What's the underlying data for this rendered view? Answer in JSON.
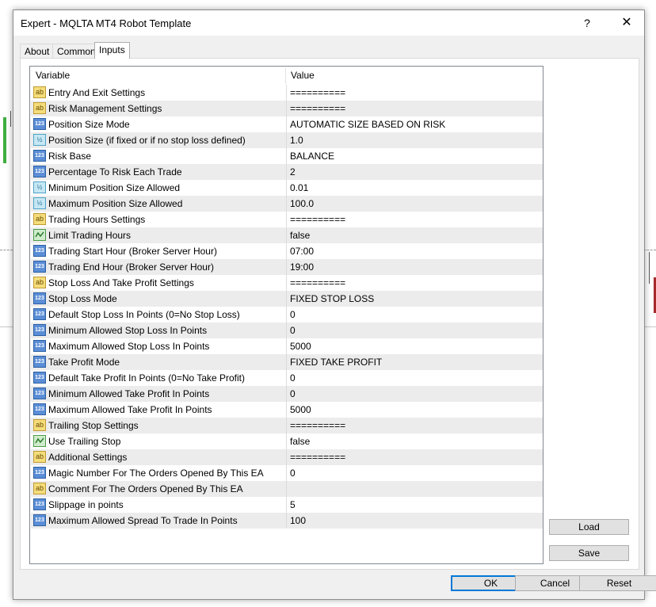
{
  "window": {
    "title": "Expert - MQLTA MT4 Robot Template",
    "help_label": "?",
    "close_label": "✕"
  },
  "tabs": [
    {
      "label": "About"
    },
    {
      "label": "Common"
    },
    {
      "label": "Inputs",
      "active": true
    }
  ],
  "grid": {
    "headers": {
      "variable": "Variable",
      "value": "Value"
    },
    "rows": [
      {
        "icon": "ab",
        "variable": "Entry And Exit Settings",
        "value": "=========="
      },
      {
        "icon": "ab",
        "variable": "Risk Management Settings",
        "value": "=========="
      },
      {
        "icon": "123",
        "variable": "Position Size Mode",
        "value": "AUTOMATIC SIZE BASED ON RISK"
      },
      {
        "icon": "v2",
        "variable": "Position Size (if fixed or if no stop loss defined)",
        "value": "1.0"
      },
      {
        "icon": "123",
        "variable": "Risk Base",
        "value": "BALANCE"
      },
      {
        "icon": "123",
        "variable": "Percentage To Risk Each Trade",
        "value": "2"
      },
      {
        "icon": "v2",
        "variable": "Minimum Position Size Allowed",
        "value": "0.01"
      },
      {
        "icon": "v2",
        "variable": "Maximum Position Size Allowed",
        "value": "100.0"
      },
      {
        "icon": "ab",
        "variable": "Trading Hours Settings",
        "value": "=========="
      },
      {
        "icon": "bool",
        "variable": "Limit Trading Hours",
        "value": "false"
      },
      {
        "icon": "123",
        "variable": "Trading Start Hour (Broker Server Hour)",
        "value": "07:00"
      },
      {
        "icon": "123",
        "variable": "Trading End Hour (Broker Server Hour)",
        "value": "19:00"
      },
      {
        "icon": "ab",
        "variable": "Stop Loss And Take Profit Settings",
        "value": "=========="
      },
      {
        "icon": "123",
        "variable": "Stop Loss Mode",
        "value": "FIXED STOP LOSS"
      },
      {
        "icon": "123",
        "variable": "Default Stop Loss In Points (0=No Stop Loss)",
        "value": "0"
      },
      {
        "icon": "123",
        "variable": "Minimum Allowed Stop Loss In Points",
        "value": "0"
      },
      {
        "icon": "123",
        "variable": "Maximum Allowed Stop Loss In Points",
        "value": "5000"
      },
      {
        "icon": "123",
        "variable": "Take Profit Mode",
        "value": "FIXED TAKE PROFIT"
      },
      {
        "icon": "123",
        "variable": "Default Take Profit In Points (0=No Take Profit)",
        "value": "0"
      },
      {
        "icon": "123",
        "variable": "Minimum Allowed Take Profit In Points",
        "value": "0"
      },
      {
        "icon": "123",
        "variable": "Maximum Allowed Take Profit In Points",
        "value": "5000"
      },
      {
        "icon": "ab",
        "variable": "Trailing Stop Settings",
        "value": "=========="
      },
      {
        "icon": "bool",
        "variable": "Use Trailing Stop",
        "value": "false"
      },
      {
        "icon": "ab",
        "variable": "Additional Settings",
        "value": "=========="
      },
      {
        "icon": "123",
        "variable": "Magic Number For The Orders Opened By This EA",
        "value": "0"
      },
      {
        "icon": "ab",
        "variable": "Comment For The Orders Opened By This EA",
        "value": ""
      },
      {
        "icon": "123",
        "variable": "Slippage in points",
        "value": "5"
      },
      {
        "icon": "123",
        "variable": "Maximum Allowed Spread To Trade In Points",
        "value": "100"
      }
    ]
  },
  "icon_text": {
    "ab": "ab",
    "123": "123",
    "v2": "½"
  },
  "side_buttons": {
    "load": "Load",
    "save": "Save"
  },
  "footer_buttons": {
    "ok": "OK",
    "cancel": "Cancel",
    "reset": "Reset"
  }
}
